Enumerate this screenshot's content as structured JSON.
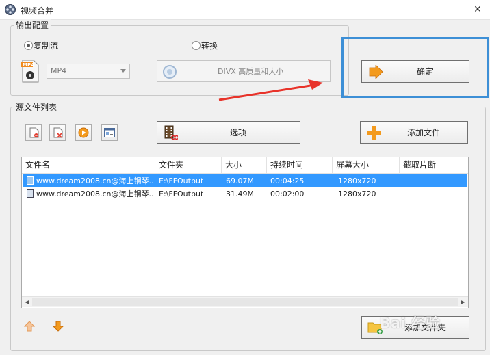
{
  "window": {
    "title": "视频合并",
    "close": "✕"
  },
  "output": {
    "group_label": "输出配置",
    "copy_stream_label": "复制流",
    "convert_label": "转换",
    "selected_mode": "复制流",
    "format_value": "MP4",
    "quality_label": "DIVX 高质量和大小",
    "confirm_label": "确定"
  },
  "source": {
    "group_label": "源文件列表",
    "options_label": "选项",
    "add_file_label": "添加文件",
    "add_folder_label": "添加文件夹",
    "columns": [
      "文件名",
      "文件夹",
      "大小",
      "持续时间",
      "屏幕大小",
      "截取片断"
    ],
    "rows": [
      {
        "name": "www.dream2008.cn@海上钢琴...",
        "folder": "E:\\FFOutput",
        "size": "69.07M",
        "duration": "00:04:25",
        "resolution": "1280x720",
        "clip": "",
        "selected": true
      },
      {
        "name": "www.dream2008.cn@海上钢琴...",
        "folder": "E:\\FFOutput",
        "size": "31.49M",
        "duration": "00:02:00",
        "resolution": "1280x720",
        "clip": "",
        "selected": false
      }
    ]
  },
  "icons": {
    "app": "film-reel-icon",
    "mp4": "mp4-file-icon",
    "quality": "quality-dial-icon",
    "confirm": "orange-arrow-icon",
    "tool1": "remove-file-icon",
    "tool2": "delete-file-icon",
    "tool3": "play-icon",
    "tool4": "info-window-icon",
    "options": "film-scissors-icon",
    "add_file": "plus-icon",
    "add_folder": "folder-add-icon",
    "move_up": "arrow-up-icon",
    "move_down": "arrow-down-icon"
  },
  "colors": {
    "selection": "#3399ff",
    "highlight": "#3d8fd6",
    "annotation": "#e8332a",
    "accent": "#f39a1d"
  },
  "watermark": "Bai 经验"
}
